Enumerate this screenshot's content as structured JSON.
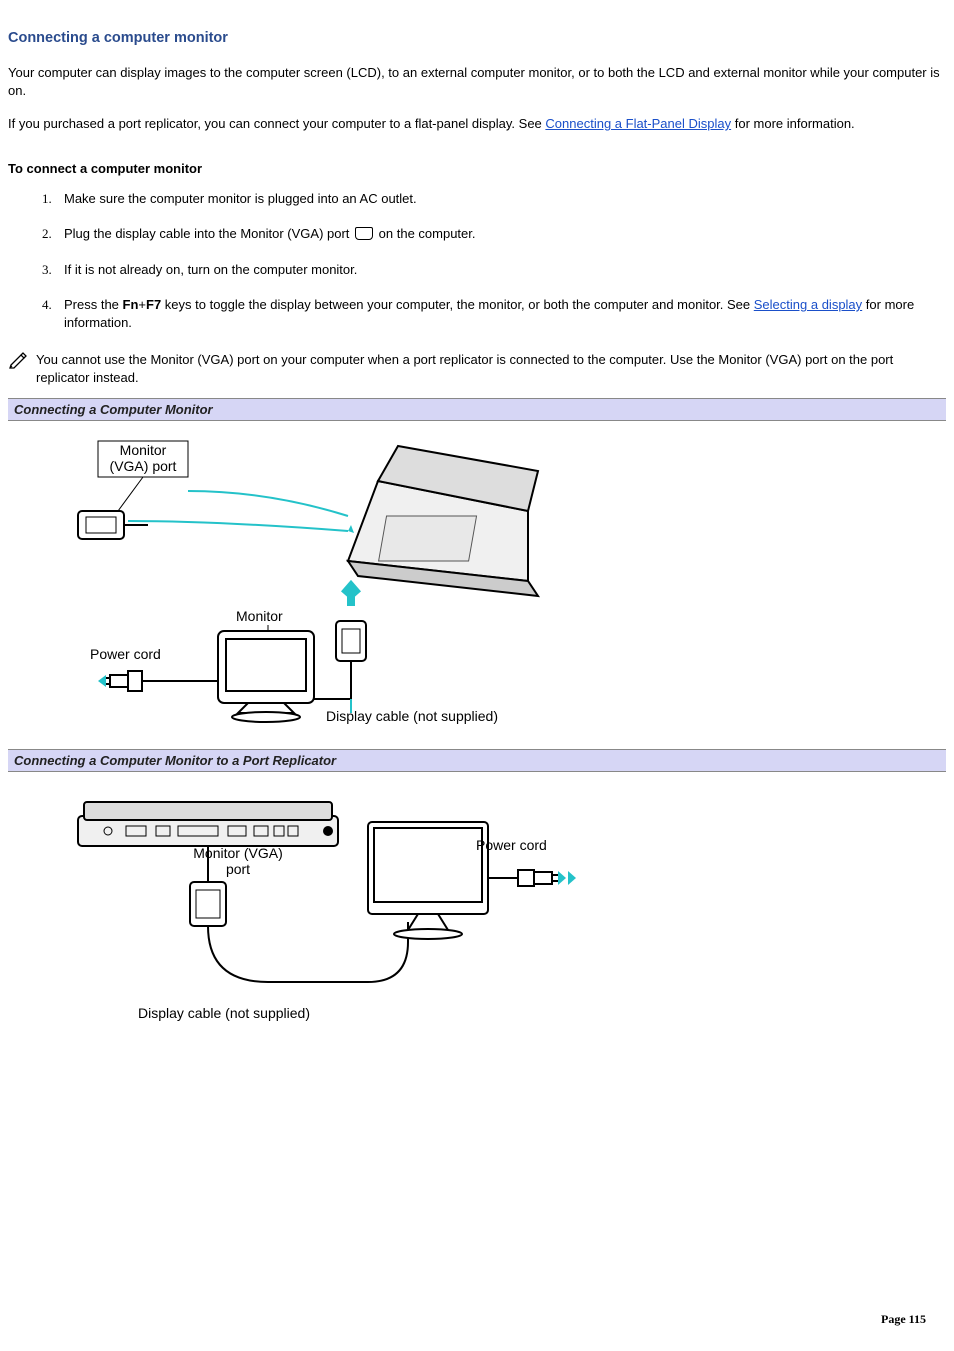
{
  "title": "Connecting a computer monitor",
  "intro1": "Your computer can display images to the computer screen (LCD), to an external computer monitor, or to both the LCD and external monitor while your computer is on.",
  "intro2_pre": "If you purchased a port replicator, you can connect your computer to a flat-panel display. See ",
  "intro2_link": "Connecting a Flat-Panel Display",
  "intro2_post": " for more information.",
  "sub_heading": "To connect a computer monitor",
  "steps": {
    "s1": "Make sure the computer monitor is plugged into an AC outlet.",
    "s2_pre": "Plug the display cable into the Monitor (VGA) port ",
    "s2_post": " on the computer.",
    "s3": "If it is not already on, turn on the computer monitor.",
    "s4_pre": "Press the ",
    "s4_key1": "Fn",
    "s4_plus": "+",
    "s4_key2": "F7",
    "s4_mid": " keys to toggle the display between your computer, the monitor, or both the computer and monitor. See ",
    "s4_link": "Selecting a display",
    "s4_post": " for more information."
  },
  "note": "You cannot use the Monitor (VGA) port on your computer when a port replicator is connected to the computer. Use the Monitor (VGA) port on the port replicator instead.",
  "figure1": {
    "caption": "Connecting a Computer Monitor",
    "labels": {
      "vga": "Monitor\n(VGA) port",
      "monitor": "Monitor",
      "power": "Power cord",
      "cable": "Display cable (not supplied)"
    }
  },
  "figure2": {
    "caption": "Connecting a Computer Monitor to a Port Replicator",
    "labels": {
      "vga": "Monitor (VGA)\nport",
      "power": "Power cord",
      "cable": "Display cable (not supplied)"
    }
  },
  "page_number": "Page 115"
}
